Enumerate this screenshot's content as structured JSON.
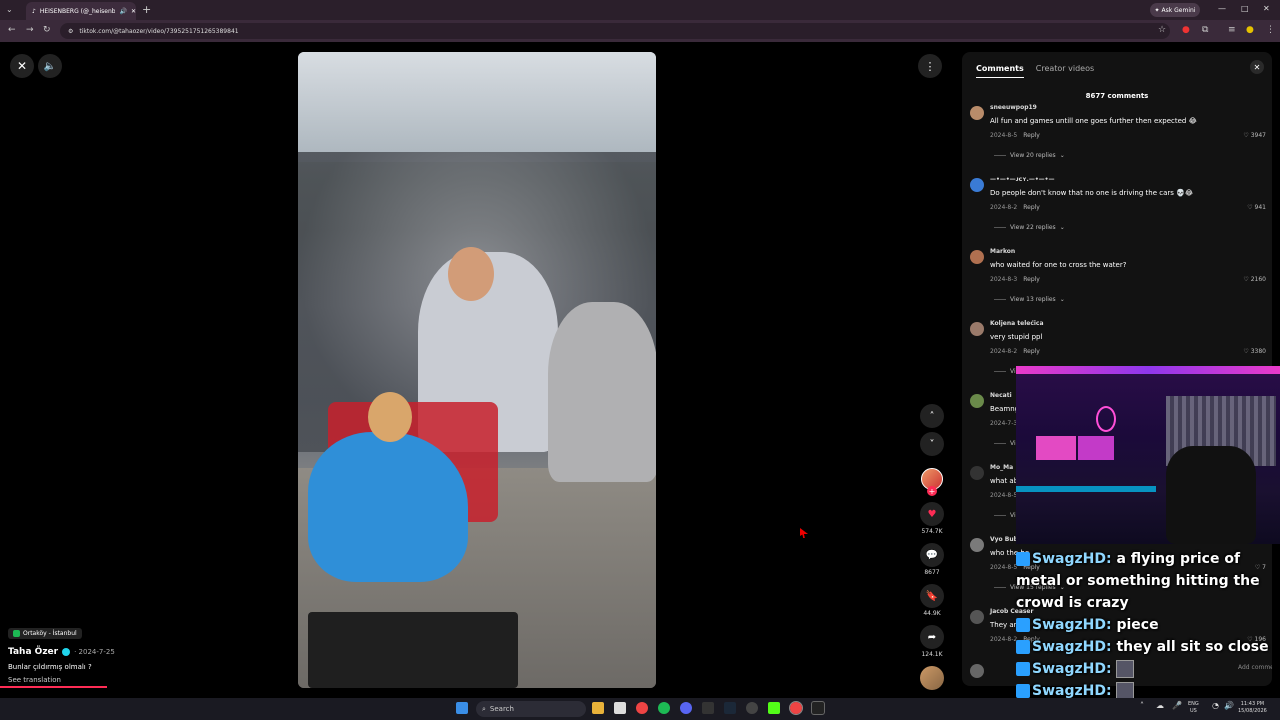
{
  "browser": {
    "tab_title": "HEISENBERG (@_heisenb...",
    "new_tab": "+",
    "ask_gemini": "Ask Gemini",
    "url": "tiktok.com/@tahaozer/video/7395251751265389841",
    "window_controls": {
      "minimize": "—",
      "maximize": "□",
      "close": "✕"
    }
  },
  "player": {
    "close_icon": "close-icon",
    "volume_icon": "volume-icon",
    "more_icon": "more-icon",
    "progress": 0.3
  },
  "creator": {
    "location": "Ortaköy - İstanbul",
    "name": "Taha Özer",
    "date": "· 2024-7-25",
    "caption": "Bunlar çıldırmış olmalı ?",
    "see_translation": "See translation"
  },
  "actions": {
    "likes": "574.7K",
    "comments": "8677",
    "saves": "44.9K",
    "shares": "124.1K"
  },
  "panel": {
    "tabs": [
      {
        "label": "Comments",
        "active": true
      },
      {
        "label": "Creator videos",
        "active": false
      }
    ],
    "count_label": "8677 comments",
    "comments": [
      {
        "user": "sneeuwpop19",
        "text": "All fun and games untill one goes further then expected 😂",
        "date": "2024-8-5",
        "reply": "Reply",
        "likes": "3947",
        "replies": "View 20 replies",
        "color": "#b98c6a"
      },
      {
        "user": "—•—•—ᴊᴄʏ.—•—•—",
        "text": "Do people don't know that no one is driving the cars 💀😂",
        "date": "2024-8-2",
        "reply": "Reply",
        "likes": "941",
        "replies": "View 22 replies",
        "color": "#3a7bd5"
      },
      {
        "user": "Markon",
        "text": "who waited for one to cross the water?",
        "date": "2024-8-3",
        "reply": "Reply",
        "likes": "2160",
        "replies": "View 13 replies",
        "color": "#b07050"
      },
      {
        "user": "Koljena telećica",
        "text": "very stupid ppl",
        "date": "2024-8-2",
        "reply": "Reply",
        "likes": "3380",
        "replies": "View",
        "color": "#9a7a6a"
      },
      {
        "user": "Necati",
        "text": "Beamng",
        "date": "2024-7-31",
        "reply": "",
        "likes": "",
        "replies": "View",
        "color": "#6a8a4a"
      },
      {
        "user": "Mo_Ma",
        "text": "what abo",
        "date": "2024-8-5",
        "reply": "",
        "likes": "",
        "replies": "View",
        "color": "#333333"
      },
      {
        "user": "Vyo Bubu Güneri",
        "text": "who the he",
        "date": "2024-8-5",
        "reply": "Reply",
        "likes": "7",
        "replies": "View 15 replies",
        "color": "#7a7a7a"
      },
      {
        "user": "Jacob Ceaser",
        "text": "They are s",
        "date": "2024-8-2",
        "reply": "Reply",
        "likes": "196",
        "replies": "",
        "color": "#555555"
      }
    ],
    "add_comment_placeholder": "Add comment..."
  },
  "chat": [
    {
      "user": "SwagzHD:",
      "text": " a flying price of metal or something hitting the crowd is crazy",
      "emote": false
    },
    {
      "user": "SwagzHD:",
      "text": " piece",
      "emote": false
    },
    {
      "user": "SwagzHD:",
      "text": " they all sit so close",
      "emote": false
    },
    {
      "user": "SwagzHD:",
      "text": "",
      "emote": true
    },
    {
      "user": "SwagzHD:",
      "text": "",
      "emote": true
    }
  ],
  "taskbar": {
    "search_label": "Search",
    "lang": "ENG",
    "region": "US",
    "time": "11:43 PM",
    "date": "15/08/2026"
  }
}
